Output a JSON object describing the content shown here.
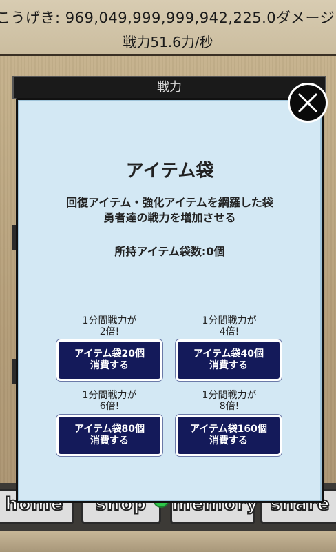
{
  "header": {
    "attack": "こうげき: 969,049,999,999,942,225.0ダメージ",
    "power_rate": "戦力51.6力/秒"
  },
  "panel": {
    "title": "戦力"
  },
  "bottom_nav": {
    "items": [
      "home",
      "shop",
      "memory",
      "share"
    ]
  },
  "modal": {
    "title": "アイテム袋",
    "description_line1": "回復アイテム・強化アイテムを網羅した袋",
    "description_line2": "勇者達の戦力を増加させる",
    "owned": "所持アイテム袋数:0個",
    "options": [
      {
        "label_line1": "1分間戦力が",
        "label_line2": "2倍!",
        "button_line1": "アイテム袋20個",
        "button_line2": "消費する"
      },
      {
        "label_line1": "1分間戦力が",
        "label_line2": "4倍!",
        "button_line1": "アイテム袋40個",
        "button_line2": "消費する"
      },
      {
        "label_line1": "1分間戦力が",
        "label_line2": "6倍!",
        "button_line1": "アイテム袋80個",
        "button_line2": "消費する"
      },
      {
        "label_line1": "1分間戦力が",
        "label_line2": "8倍!",
        "button_line1": "アイテム袋160個",
        "button_line2": "消費する"
      }
    ]
  },
  "icons": {
    "close": "close-icon"
  },
  "colors": {
    "modal_bg": "#d3e8f4",
    "button_bg": "#141a5a",
    "nav_dot": "#2ec64a"
  }
}
